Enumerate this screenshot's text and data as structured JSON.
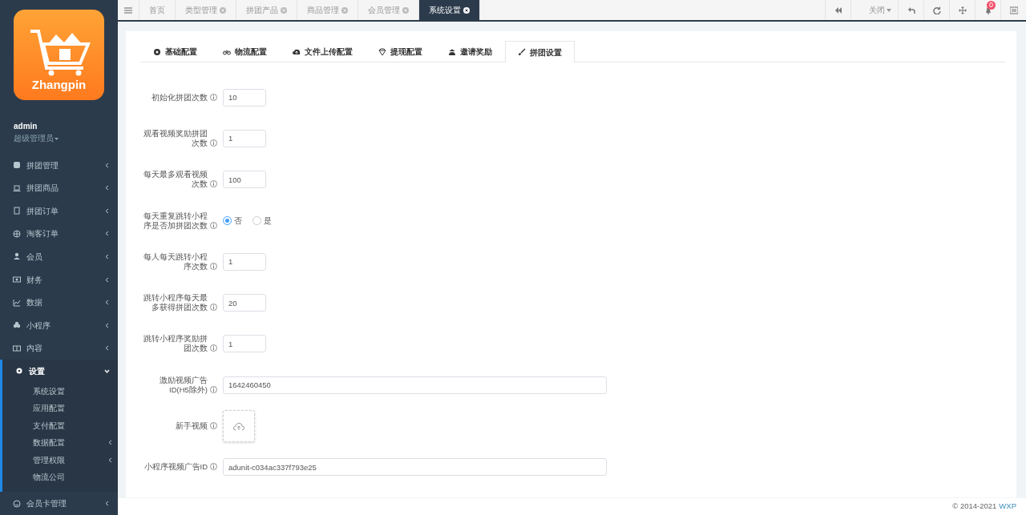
{
  "logo": {
    "text": "Zhangpin"
  },
  "user": {
    "name": "admin",
    "role": "超级管理员"
  },
  "sidebar": {
    "items": [
      {
        "label": "拼团管理",
        "expanded": false
      },
      {
        "label": "拼团商品",
        "expanded": false
      },
      {
        "label": "拼团订单",
        "expanded": false
      },
      {
        "label": "淘客订单",
        "expanded": false
      },
      {
        "label": "会员",
        "expanded": false
      },
      {
        "label": "财务",
        "expanded": false
      },
      {
        "label": "数据",
        "expanded": false
      },
      {
        "label": "小程序",
        "expanded": false
      },
      {
        "label": "内容",
        "expanded": false
      },
      {
        "label": "设置",
        "expanded": true,
        "children": [
          {
            "label": "系统设置",
            "has_submenu": false
          },
          {
            "label": "应用配置",
            "has_submenu": false
          },
          {
            "label": "支付配置",
            "has_submenu": false
          },
          {
            "label": "数据配置",
            "has_submenu": true
          },
          {
            "label": "管理权限",
            "has_submenu": true
          },
          {
            "label": "物流公司",
            "has_submenu": false
          }
        ]
      },
      {
        "label": "会员卡管理",
        "expanded": false
      }
    ]
  },
  "page_tabs": [
    {
      "label": "首页",
      "selected": false,
      "closable": false
    },
    {
      "label": "类型管理",
      "selected": false,
      "closable": true
    },
    {
      "label": "拼团产品",
      "selected": false,
      "closable": true
    },
    {
      "label": "商品管理",
      "selected": false,
      "closable": true
    },
    {
      "label": "会员管理",
      "selected": false,
      "closable": true
    },
    {
      "label": "系统设置",
      "selected": true,
      "closable": true
    }
  ],
  "toolbar": {
    "close_menu": "关闭",
    "notification_count": "0"
  },
  "settings_tabs": [
    {
      "label": "基础配置",
      "selected": false
    },
    {
      "label": "物流配置",
      "selected": false
    },
    {
      "label": "文件上传配置",
      "selected": false
    },
    {
      "label": "提现配置",
      "selected": false
    },
    {
      "label": "邀请奖励",
      "selected": false
    },
    {
      "label": "拼团设置",
      "selected": true
    }
  ],
  "form": [
    {
      "kind": "short",
      "label": "初始化拼团次数",
      "value": "10"
    },
    {
      "kind": "short",
      "label": "观看视频奖励拼团次数",
      "value": "1"
    },
    {
      "kind": "short",
      "label": "每天最多观看视频次数",
      "value": "100"
    },
    {
      "kind": "radio",
      "label": "每天重复跳转小程序是否加拼团次数",
      "options": [
        {
          "label": "否",
          "selected": true
        },
        {
          "label": "是",
          "selected": false
        }
      ]
    },
    {
      "kind": "short",
      "label": "每人每天跳转小程序次数",
      "value": "1"
    },
    {
      "kind": "short",
      "label": "跳转小程序每天最多获得拼团次数",
      "value": "20"
    },
    {
      "kind": "short",
      "label": "跳转小程序奖励拼团次数",
      "value": "1"
    },
    {
      "kind": "wide",
      "label": "激励视频广告ID(H5除外)",
      "value": "1642460450"
    },
    {
      "kind": "upload",
      "label": "新手视频"
    },
    {
      "kind": "wide",
      "label": "小程序视频广告ID",
      "value": "adunit-c034ac337f793e25"
    }
  ],
  "footer": {
    "copyright": "© 2014-2021",
    "link": "WXP"
  }
}
